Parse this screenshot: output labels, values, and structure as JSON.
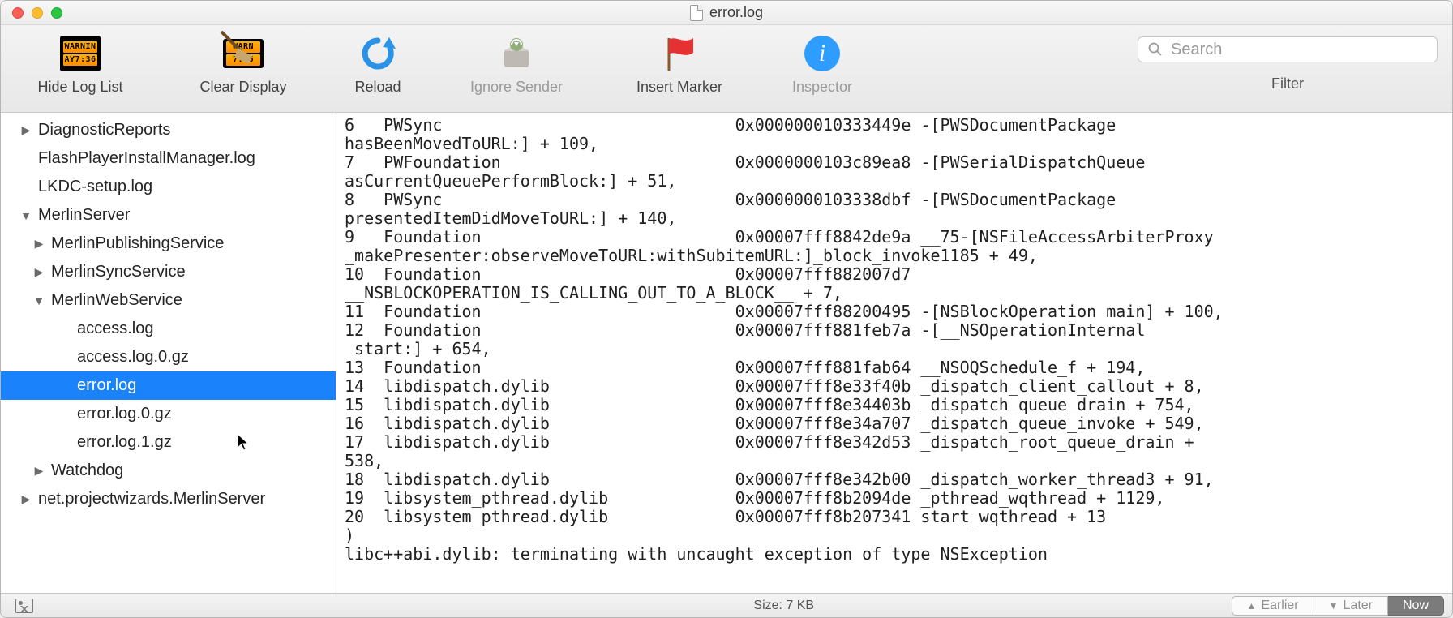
{
  "window": {
    "title": "error.log"
  },
  "toolbar": {
    "items": [
      {
        "id": "hide-log-list",
        "label": "Hide Log List"
      },
      {
        "id": "clear-display",
        "label": "Clear Display"
      },
      {
        "id": "reload",
        "label": "Reload"
      },
      {
        "id": "ignore-sender",
        "label": "Ignore Sender",
        "disabled": true
      },
      {
        "id": "insert-marker",
        "label": "Insert Marker"
      },
      {
        "id": "inspector",
        "label": "Inspector",
        "disabled": true
      }
    ],
    "search_placeholder": "Search",
    "filter_label": "Filter"
  },
  "sidebar": {
    "items": [
      {
        "label": "DiagnosticReports",
        "depth": 0,
        "arrow": "right"
      },
      {
        "label": "FlashPlayerInstallManager.log",
        "depth": 0,
        "arrow": ""
      },
      {
        "label": "LKDC-setup.log",
        "depth": 0,
        "arrow": ""
      },
      {
        "label": "MerlinServer",
        "depth": 0,
        "arrow": "down"
      },
      {
        "label": "MerlinPublishingService",
        "depth": 1,
        "arrow": "right"
      },
      {
        "label": "MerlinSyncService",
        "depth": 1,
        "arrow": "right"
      },
      {
        "label": "MerlinWebService",
        "depth": 1,
        "arrow": "down"
      },
      {
        "label": "access.log",
        "depth": 2,
        "arrow": ""
      },
      {
        "label": "access.log.0.gz",
        "depth": 2,
        "arrow": ""
      },
      {
        "label": "error.log",
        "depth": 2,
        "arrow": "",
        "selected": true
      },
      {
        "label": "error.log.0.gz",
        "depth": 2,
        "arrow": ""
      },
      {
        "label": "error.log.1.gz",
        "depth": 2,
        "arrow": ""
      },
      {
        "label": "Watchdog",
        "depth": 1,
        "arrow": "right"
      },
      {
        "label": "net.projectwizards.MerlinServer",
        "depth": 0,
        "arrow": "right"
      }
    ]
  },
  "log_lines": [
    "6   PWSync                              0x000000010333449e -[PWSDocumentPackage hasBeenMovedToURL:] + 109,",
    "7   PWFoundation                        0x0000000103c89ea8 -[PWSerialDispatchQueue asCurrentQueuePerformBlock:] + 51,",
    "8   PWSync                              0x0000000103338dbf -[PWSDocumentPackage presentedItemDidMoveToURL:] + 140,",
    "9   Foundation                          0x00007fff8842de9a __75-[NSFileAccessArbiterProxy _makePresenter:observeMoveToURL:withSubitemURL:]_block_invoke1185 + 49,",
    "10  Foundation                          0x00007fff882007d7 __NSBLOCKOPERATION_IS_CALLING_OUT_TO_A_BLOCK__ + 7,",
    "11  Foundation                          0x00007fff88200495 -[NSBlockOperation main] + 100,",
    "12  Foundation                          0x00007fff881feb7a -[__NSOperationInternal _start:] + 654,",
    "13  Foundation                          0x00007fff881fab64 __NSOQSchedule_f + 194,",
    "14  libdispatch.dylib                   0x00007fff8e33f40b _dispatch_client_callout + 8,",
    "15  libdispatch.dylib                   0x00007fff8e34403b _dispatch_queue_drain + 754,",
    "16  libdispatch.dylib                   0x00007fff8e34a707 _dispatch_queue_invoke + 549,",
    "17  libdispatch.dylib                   0x00007fff8e342d53 _dispatch_root_queue_drain + 538,",
    "18  libdispatch.dylib                   0x00007fff8e342b00 _dispatch_worker_thread3 + 91,",
    "19  libsystem_pthread.dylib             0x00007fff8b2094de _pthread_wqthread + 1129,",
    "20  libsystem_pthread.dylib             0x00007fff8b207341 start_wqthread + 13",
    ")",
    "libc++abi.dylib: terminating with uncaught exception of type NSException"
  ],
  "statusbar": {
    "size": "Size: 7 KB",
    "earlier": "Earlier",
    "later": "Later",
    "now": "Now"
  }
}
